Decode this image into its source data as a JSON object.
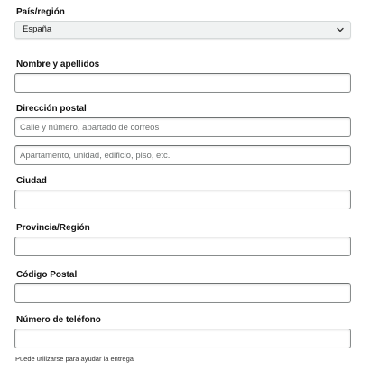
{
  "country": {
    "label": "País/región",
    "selected": "España"
  },
  "full_name": {
    "label": "Nombre y apellidos",
    "value": "",
    "placeholder": ""
  },
  "address": {
    "label": "Dirección postal",
    "line1_placeholder": "Calle y número, apartado de correos",
    "line2_placeholder": "Apartamento, unidad, edificio, piso, etc."
  },
  "city": {
    "label": "Ciudad",
    "value": ""
  },
  "province": {
    "label": "Provincia/Región",
    "value": ""
  },
  "postal_code": {
    "label": "Código Postal",
    "value": ""
  },
  "phone": {
    "label": "Número de teléfono",
    "value": "",
    "helper": "Puede utilizarse para ayudar la entrega"
  },
  "icons": {
    "dropdown": "chevron-down-icon"
  }
}
